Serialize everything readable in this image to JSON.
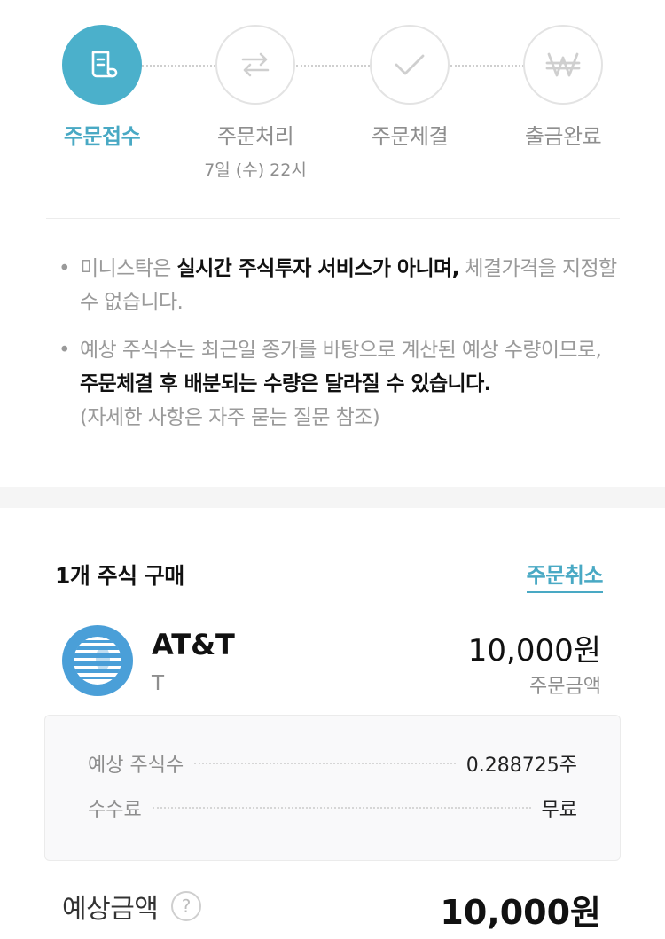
{
  "steps": [
    {
      "label": "주문접수",
      "sub": "",
      "icon": "receipt-icon",
      "active": true
    },
    {
      "label": "주문처리",
      "sub": "7일 (수) 22시",
      "icon": "exchange-arrows-icon",
      "active": false
    },
    {
      "label": "주문체결",
      "sub": "",
      "icon": "check-icon",
      "active": false
    },
    {
      "label": "출금완료",
      "sub": "",
      "icon": "won-currency-icon",
      "active": false
    }
  ],
  "notices": {
    "n1": {
      "a": "미니스탁은 ",
      "b": "실시간 주식투자 서비스가 아니며,",
      "c": " 체결가격을 지정할 수 없습니다."
    },
    "n2": {
      "a": "예상 주식수는 최근일 종가를 바탕으로 계산된 예상 수량이므로, ",
      "b": "주문체결 후 배분되는 수량은 달라질 수 있습니다.",
      "c": "(자세한 사항은 자주 묻는 질문 참조)"
    }
  },
  "order": {
    "title": "1개 주식 구매",
    "cancel_label": "주문취소",
    "stock_name": "AT&T",
    "ticker": "T",
    "amount": "10,000원",
    "amount_label": "주문금액",
    "details": [
      {
        "key": "예상 주식수",
        "value": "0.288725주"
      },
      {
        "key": "수수료",
        "value": "무료"
      }
    ],
    "expected_label": "예상금액",
    "expected_amount": "10,000원"
  },
  "colors": {
    "accent": "#4bb0cb",
    "logo": "#4a9fd8"
  }
}
